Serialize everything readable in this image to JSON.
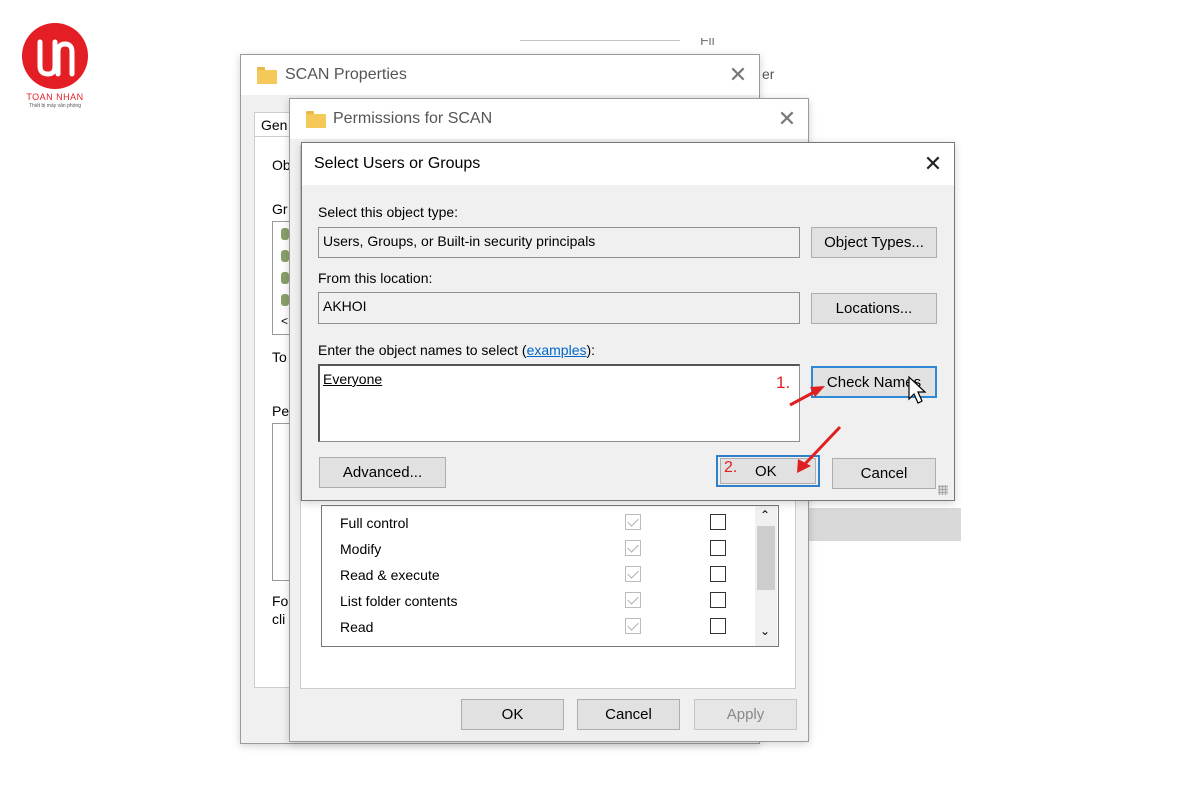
{
  "brand": {
    "name": "TOAN NHAN",
    "tagline": "Thiết bị máy văn phòng",
    "color": "#e31e24"
  },
  "background": {
    "column_text": "Fil",
    "row_text": "er"
  },
  "scan_properties": {
    "title": "SCAN Properties",
    "tab_cut": "Gen",
    "cut_labels": [
      "Ob",
      "Gr",
      "To",
      "Pe",
      "Fo",
      "cli"
    ]
  },
  "permissions": {
    "title": "Permissions for SCAN",
    "rows": [
      {
        "label": "Full control",
        "allow": true,
        "deny": false
      },
      {
        "label": "Modify",
        "allow": true,
        "deny": false
      },
      {
        "label": "Read & execute",
        "allow": true,
        "deny": false
      },
      {
        "label": "List folder contents",
        "allow": true,
        "deny": false
      },
      {
        "label": "Read",
        "allow": true,
        "deny": false
      }
    ],
    "ok_label": "OK",
    "cancel_label": "Cancel",
    "apply_label": "Apply"
  },
  "select_users": {
    "title": "Select Users or Groups",
    "object_type_label": "Select this object type:",
    "object_type_value": "Users, Groups, or Built-in security principals",
    "object_types_button": "Object Types...",
    "location_label": "From this location:",
    "location_value": "AKHOI",
    "locations_button": "Locations...",
    "enter_names_prefix": "Enter the object names to select (",
    "examples_link": "examples",
    "enter_names_suffix": "):",
    "names_value": "Everyone",
    "check_names_button": "Check Names",
    "advanced_button": "Advanced...",
    "ok_button": "OK",
    "cancel_button": "Cancel"
  },
  "annotations": {
    "step1": "1.",
    "step2": "2.",
    "color": "#e02020"
  }
}
